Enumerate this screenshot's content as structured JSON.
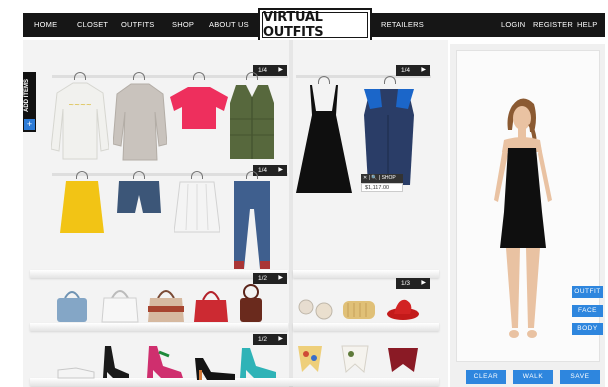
{
  "nav": {
    "home": "HOME",
    "closet": "CLOSET",
    "outfits": "OUTFITS",
    "shop": "SHOP",
    "about": "ABOUT US",
    "retailers": "RETAILERS",
    "login": "LOGIN",
    "register": "REGISTER",
    "help": "HELP",
    "logo": "VIRTUAL OUTFITS"
  },
  "closet": {
    "add_items": "ADD ITEMS",
    "add_icon": "plus-icon",
    "pagers": {
      "tops": "1/4",
      "dresses": "1/4",
      "bottoms": "1/4",
      "bags": "1/2",
      "accessories": "1/3",
      "shoes": "1/2"
    },
    "popup": {
      "actions": "✕ | 🔍 | SHOP",
      "price": "$1,117.00"
    }
  },
  "avatar": {
    "side_buttons": [
      "OUTFIT",
      "FACE",
      "BODY"
    ],
    "bottom_buttons": [
      "CLEAR",
      "WALK",
      "SAVE"
    ]
  },
  "colors": {
    "nav_bg": "#161616",
    "accent": "#2e86de",
    "closet_bg": "#f3f3f3"
  }
}
